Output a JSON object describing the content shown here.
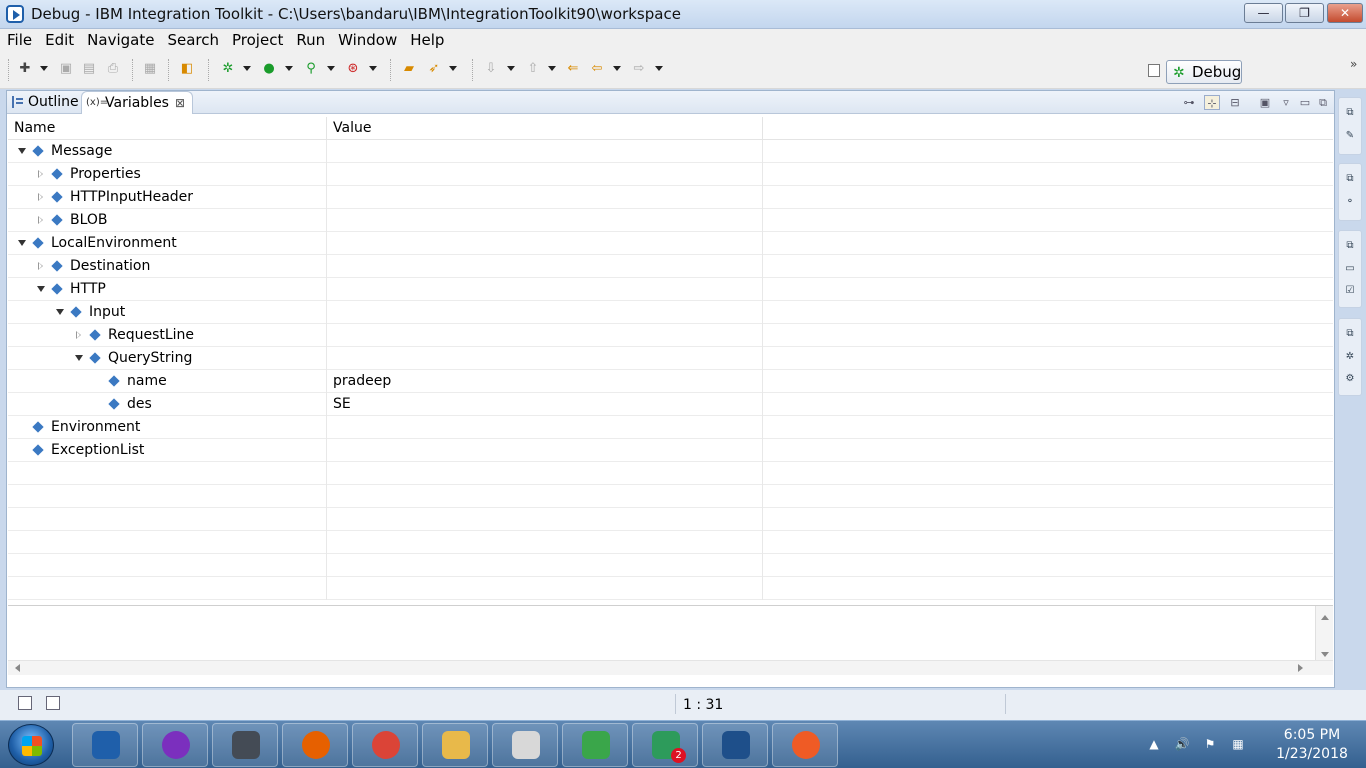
{
  "window": {
    "title": "Debug - IBM Integration Toolkit - C:\\Users\\bandaru\\IBM\\IntegrationToolkit90\\workspace",
    "min_symbol": "—",
    "max_symbol": "❐",
    "close_symbol": "✕"
  },
  "menu": [
    "File",
    "Edit",
    "Navigate",
    "Search",
    "Project",
    "Run",
    "Window",
    "Help"
  ],
  "toolbar": {
    "perspective_label": "Debug"
  },
  "view": {
    "tabs": [
      {
        "label": "Outline",
        "active": false
      },
      {
        "label": "Variables",
        "active": true,
        "icon": "(x)="
      }
    ],
    "columns": [
      "Name",
      "Value"
    ],
    "rows": [
      {
        "name": "Message",
        "value": "",
        "depth": 0,
        "expander": "open"
      },
      {
        "name": "Properties",
        "value": "",
        "depth": 1,
        "expander": "closed"
      },
      {
        "name": "HTTPInputHeader",
        "value": "",
        "depth": 1,
        "expander": "closed"
      },
      {
        "name": "BLOB",
        "value": "",
        "depth": 1,
        "expander": "closed"
      },
      {
        "name": "LocalEnvironment",
        "value": "",
        "depth": 0,
        "expander": "open"
      },
      {
        "name": "Destination",
        "value": "",
        "depth": 1,
        "expander": "closed"
      },
      {
        "name": "HTTP",
        "value": "",
        "depth": 1,
        "expander": "open"
      },
      {
        "name": "Input",
        "value": "",
        "depth": 2,
        "expander": "open"
      },
      {
        "name": "RequestLine",
        "value": "",
        "depth": 3,
        "expander": "closed"
      },
      {
        "name": "QueryString",
        "value": "",
        "depth": 3,
        "expander": "open"
      },
      {
        "name": "name",
        "value": "pradeep",
        "depth": 4,
        "expander": "none"
      },
      {
        "name": "des",
        "value": "SE",
        "depth": 4,
        "expander": "none"
      },
      {
        "name": "Environment",
        "value": "",
        "depth": 0,
        "expander": "none"
      },
      {
        "name": "ExceptionList",
        "value": "",
        "depth": 0,
        "expander": "none"
      }
    ],
    "empty_rows": 6
  },
  "status": {
    "position": "1 : 31"
  },
  "taskbar": {
    "time": "6:05 PM",
    "date": "1/23/2018",
    "badge_count": "2",
    "apps": [
      {
        "icon": "integration-toolkit-icon",
        "color": "#1f5faa"
      },
      {
        "icon": "globe-icon",
        "color": "#7b2fbe"
      },
      {
        "icon": "mountain-photo-icon",
        "color": "#444b55"
      },
      {
        "icon": "firefox-icon",
        "color": "#e66000"
      },
      {
        "icon": "chrome-icon",
        "color": "#db4437"
      },
      {
        "icon": "file-explorer-icon",
        "color": "#e8b94a"
      },
      {
        "icon": "snipping-tool-icon",
        "color": "#d8d8d8"
      },
      {
        "icon": "green-s-icon",
        "color": "#3aa64a"
      },
      {
        "icon": "pinwheel-icon",
        "color": "#2d9b5b"
      },
      {
        "icon": "command-prompt-icon",
        "color": "#1e4f8a"
      },
      {
        "icon": "postman-icon",
        "color": "#ef5b25"
      }
    ]
  },
  "colors": {
    "tree_diamond": "#3b79c2",
    "debug_green": "#1a9c2b"
  }
}
